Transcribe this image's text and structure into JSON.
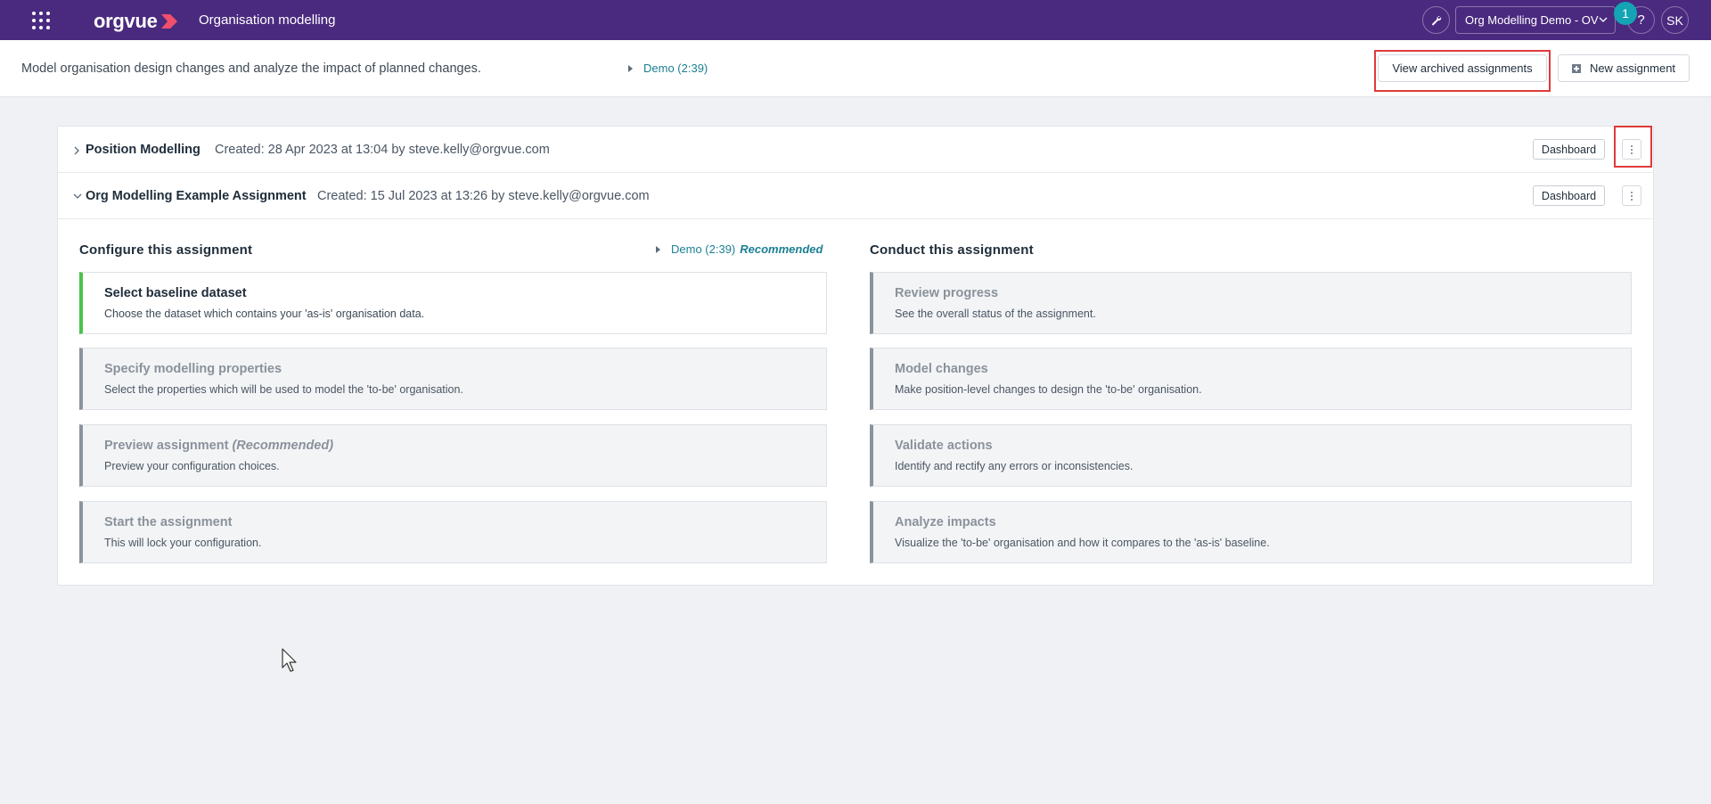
{
  "app": {
    "logo_text": "orgvue",
    "title": "Organisation modelling",
    "workspace": "Org Modelling Demo - OV",
    "notification_count": "1",
    "help_label": "?",
    "avatar_initials": "SK",
    "brand_color": "#4a2a7f"
  },
  "subheader": {
    "description": "Model organisation design changes and analyze the impact of planned changes.",
    "demo_link": "Demo (2:39)",
    "archived_button": "View archived assignments",
    "new_button": "New assignment"
  },
  "assignments": [
    {
      "name": "Position Modelling",
      "meta": "Created: 28 Apr 2023 at 13:04 by steve.kelly@orgvue.com",
      "dashboard_label": "Dashboard",
      "expanded": false
    },
    {
      "name": "Org Modelling Example Assignment",
      "meta": "Created: 15 Jul 2023 at 13:26 by steve.kelly@orgvue.com",
      "dashboard_label": "Dashboard",
      "expanded": true
    }
  ],
  "configure": {
    "title": "Configure this assignment",
    "demo_link": "Demo (2:39)",
    "demo_badge": "Recommended",
    "steps": [
      {
        "title": "Select baseline dataset",
        "title_suffix": "",
        "desc": "Choose the dataset which contains your 'as-is' organisation data.",
        "active": true
      },
      {
        "title": "Specify modelling properties",
        "title_suffix": "",
        "desc": "Select the properties which will be used to model the 'to-be' organisation.",
        "active": false
      },
      {
        "title": "Preview assignment",
        "title_suffix": "(Recommended)",
        "desc": "Preview your configuration choices.",
        "active": false
      },
      {
        "title": "Start the assignment",
        "title_suffix": "",
        "desc": "This will lock your configuration.",
        "active": false
      }
    ]
  },
  "conduct": {
    "title": "Conduct this assignment",
    "steps": [
      {
        "title": "Review progress",
        "desc": "See the overall status of the assignment."
      },
      {
        "title": "Model changes",
        "desc": "Make position-level changes to design the 'to-be' organisation."
      },
      {
        "title": "Validate actions",
        "desc": "Identify and rectify any errors or inconsistencies."
      },
      {
        "title": "Analyze impacts",
        "desc": "Visualize the 'to-be' organisation and how it compares to the 'as-is' baseline."
      }
    ]
  }
}
